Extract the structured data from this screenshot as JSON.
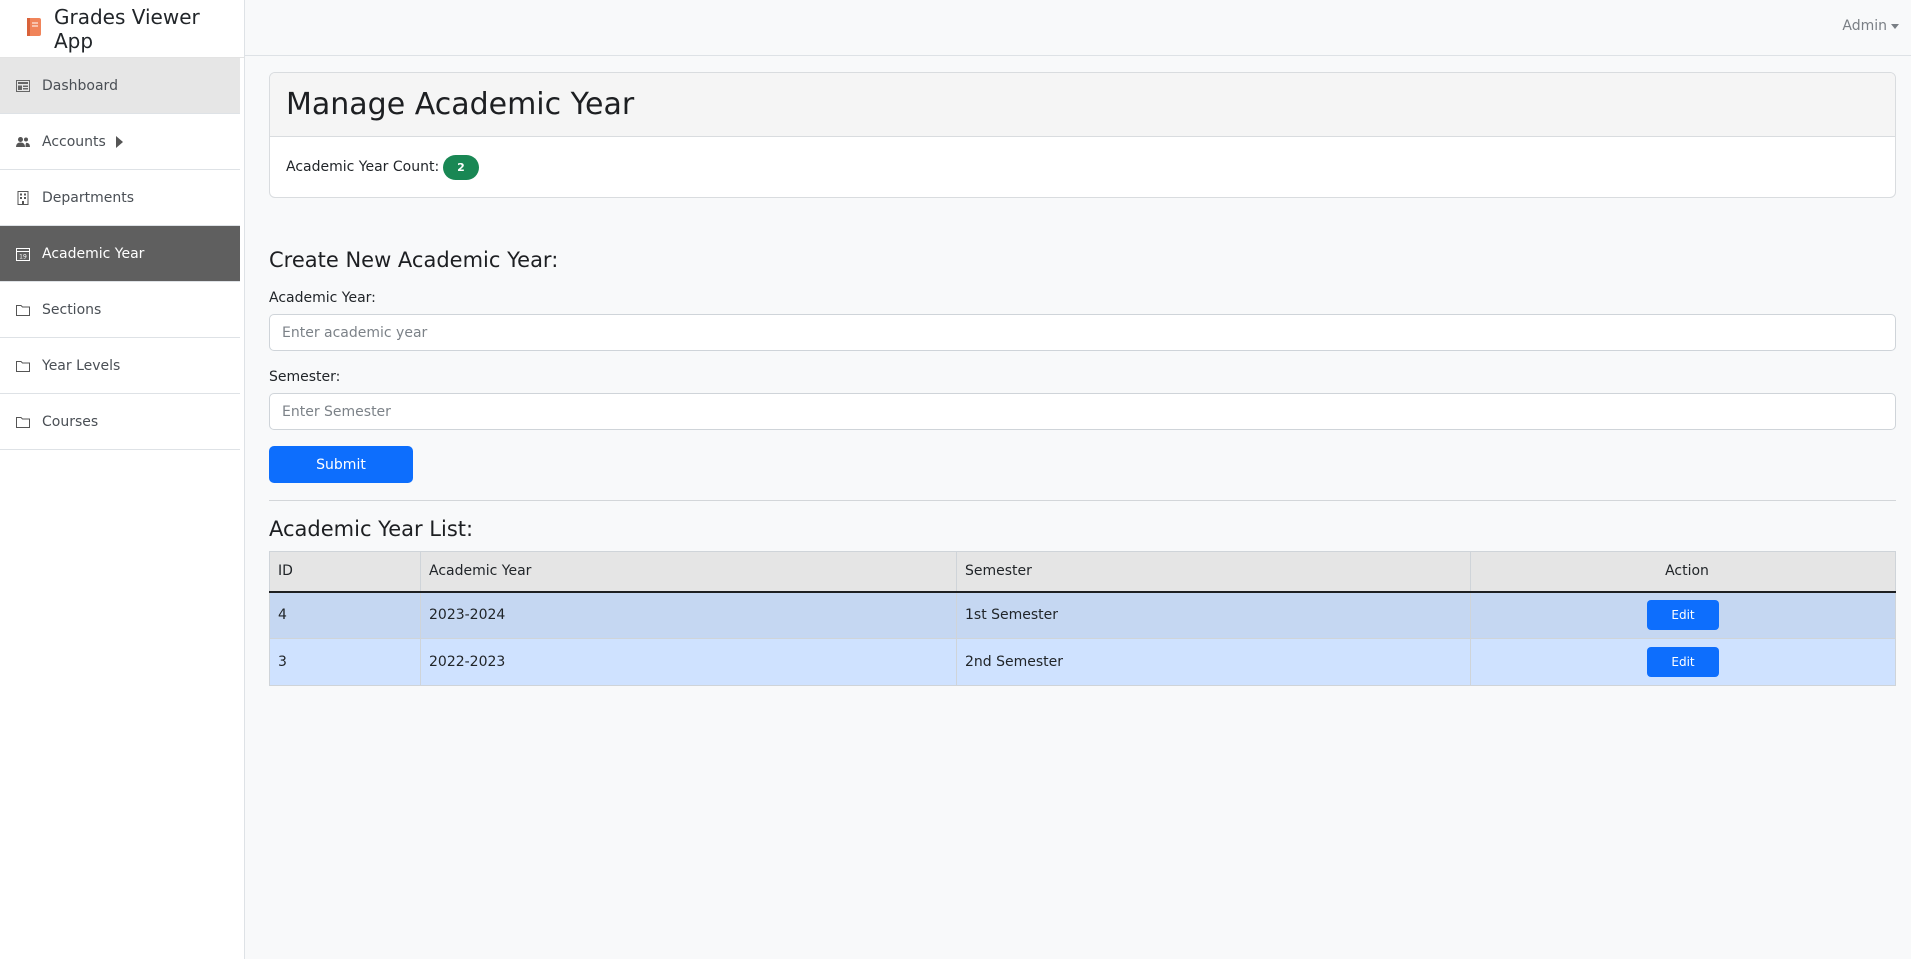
{
  "app": {
    "title": "Grades Viewer App",
    "brand_icon": "book-icon",
    "accent_color": "#0d6efd"
  },
  "sidebar": {
    "items": [
      {
        "label": "Dashboard",
        "icon": "dashboard-icon"
      },
      {
        "label": "Accounts",
        "icon": "users-icon"
      },
      {
        "label": "Departments",
        "icon": "building-icon"
      },
      {
        "label": "Academic Year",
        "icon": "calendar-icon"
      },
      {
        "label": "Sections",
        "icon": "folder-icon"
      },
      {
        "label": "Year Levels",
        "icon": "folder-icon"
      },
      {
        "label": "Courses",
        "icon": "folder-icon"
      }
    ],
    "active": "Academic Year"
  },
  "topbar": {
    "user_label": "Admin"
  },
  "main": {
    "page_title": "Manage Academic Year",
    "count_label": "Academic Year Count:",
    "count_value": "2",
    "create_title": "Create New Academic Year:",
    "form": {
      "year_label": "Academic Year:",
      "year_placeholder": "Enter academic year",
      "semester_label": "Semester:",
      "semester_placeholder": "Enter Semester",
      "submit_label": "Submit"
    },
    "list_title": "Academic Year List:",
    "table": {
      "headers": [
        "ID",
        "Academic Year",
        "Semester",
        "Action"
      ],
      "rows": [
        {
          "id": "4",
          "year": "2023-2024",
          "semester": "1st Semester",
          "action": "Edit"
        },
        {
          "id": "3",
          "year": "2022-2023",
          "semester": "2nd Semester",
          "action": "Edit"
        }
      ]
    }
  }
}
